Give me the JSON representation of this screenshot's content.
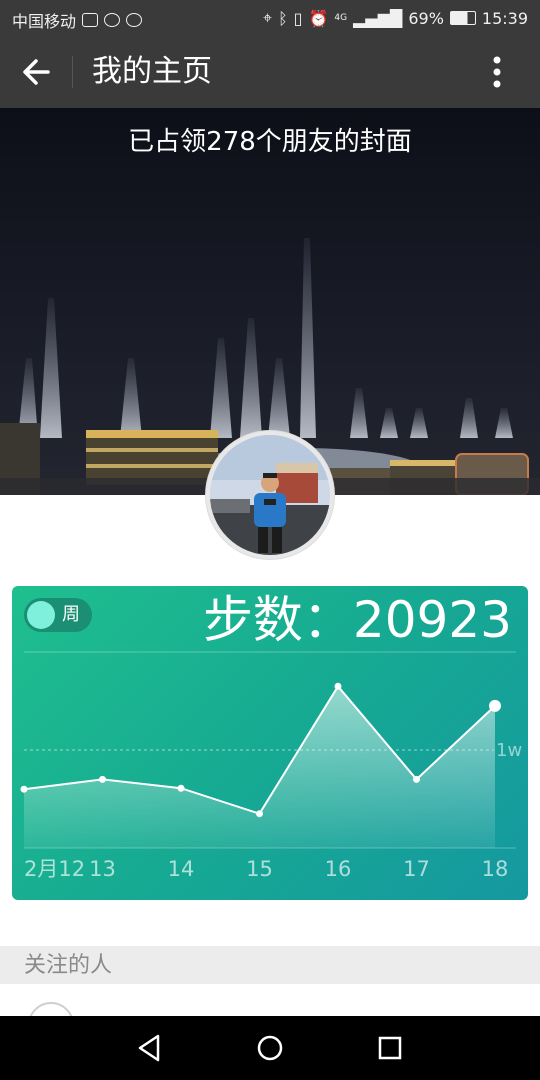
{
  "status_bar": {
    "carrier": "中国移动",
    "network": "4G",
    "battery": "69%",
    "time": "15:39"
  },
  "title_bar": {
    "title": "我的主页",
    "back_icon": "arrow-left-icon",
    "more_icon": "more-vertical-icon"
  },
  "cover": {
    "caption": "已占领278个朋友的封面"
  },
  "steps_card": {
    "toggle_label": "周",
    "steps_text": "步数：20923"
  },
  "chart_data": {
    "type": "area",
    "categories": [
      "2月12",
      "13",
      "14",
      "15",
      "16",
      "17",
      "18"
    ],
    "series": [
      {
        "values": [
          6000,
          7000,
          6100,
          3500,
          16500,
          7000,
          14500
        ]
      }
    ],
    "reference_line": {
      "value": 10000,
      "label": "1w"
    },
    "ylim": [
      0,
      20000
    ],
    "grid": false,
    "colors": {
      "line": "#ffffff",
      "fill": "#ffffff"
    }
  },
  "follow_section": {
    "label": "关注的人"
  },
  "colors": {
    "bar": "#3a3a3a",
    "card_start": "#1fbf8f",
    "card_end": "#1598a0",
    "section_bg": "#ececec"
  }
}
